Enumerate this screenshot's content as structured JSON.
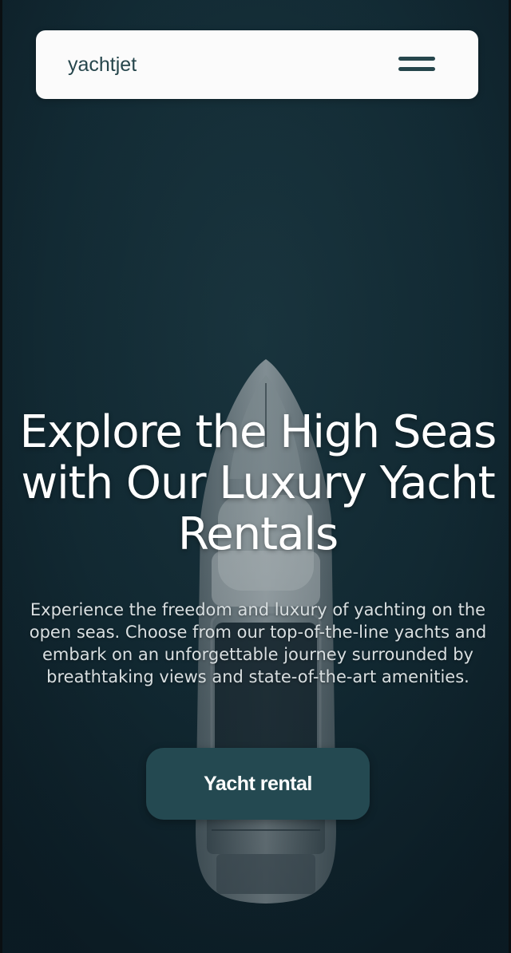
{
  "header": {
    "logo_text": "yachtjet",
    "menu_icon": "hamburger-menu-icon"
  },
  "hero": {
    "title": "Explore the High Seas with Our Luxury Yacht Rentals",
    "description": "Experience the freedom and luxury of yachting on the open seas. Choose from our top-of-the-line yachts and embark on an unforgettable journey surrounded by breathtaking views and state-of-the-art amenities.",
    "cta_label": "Yacht rental",
    "background_image": "aerial-yacht-on-dark-sea"
  },
  "colors": {
    "accent": "#244951",
    "navbar_bg": "#fbfbfb",
    "logo_text": "#26464c",
    "sea_dark": "#0f2530"
  }
}
